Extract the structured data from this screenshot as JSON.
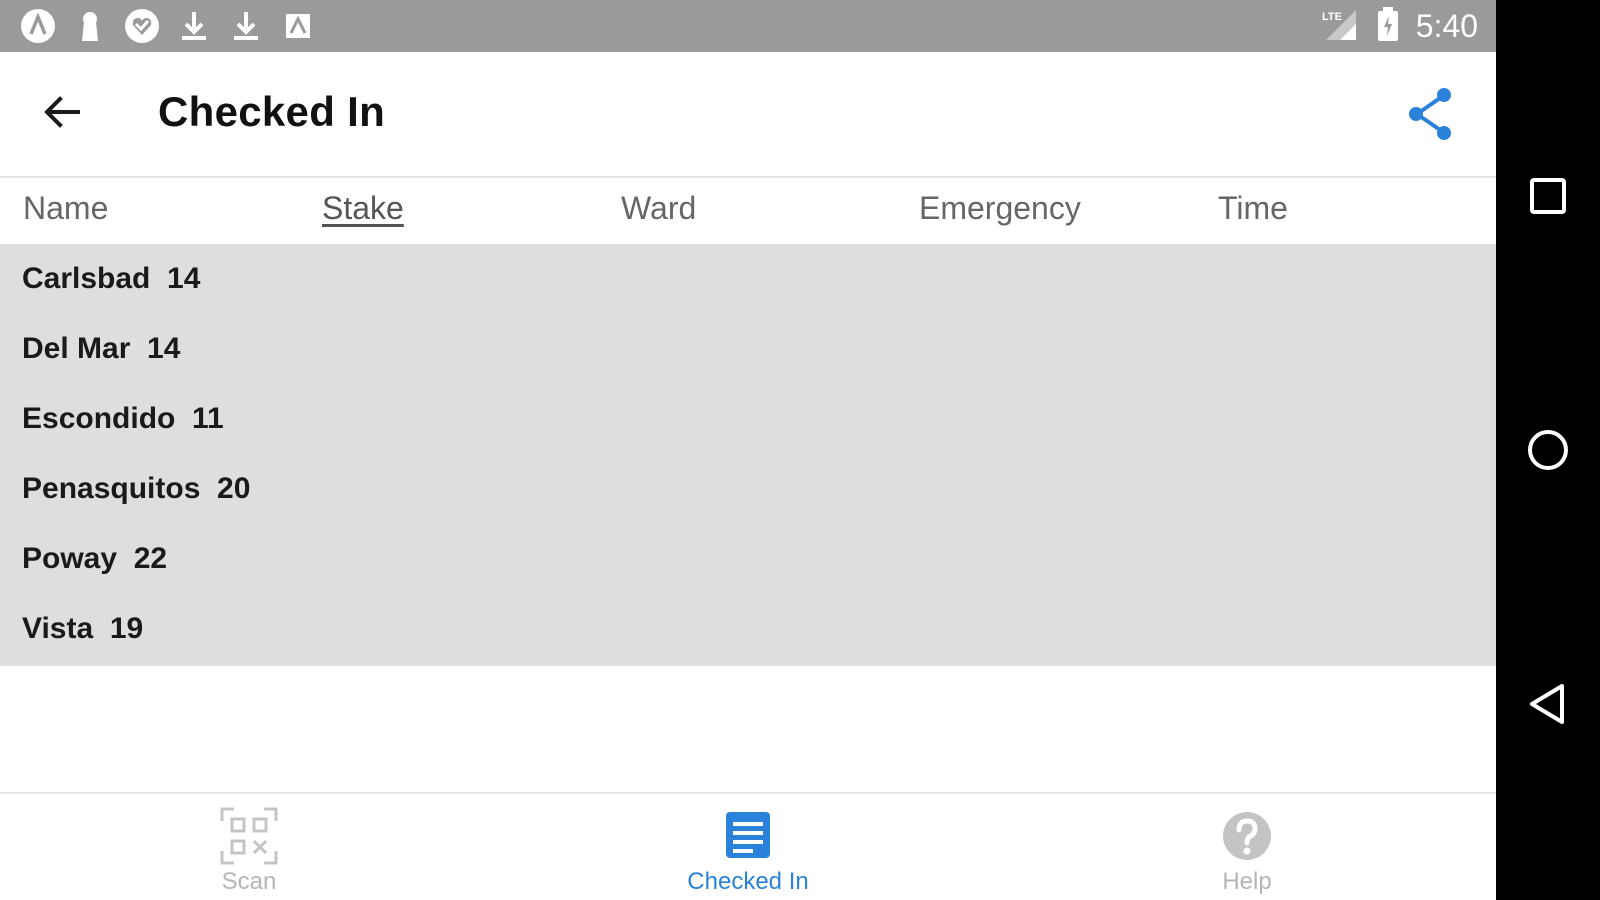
{
  "status_bar": {
    "time": "5:40",
    "notification_icons": [
      "app-a-icon",
      "keyhole-icon",
      "heart-icon",
      "download-icon",
      "download-icon",
      "image-icon"
    ],
    "network_label": "LTE"
  },
  "app_bar": {
    "title": "Checked In",
    "accent_color": "#2a82da"
  },
  "table": {
    "columns": [
      {
        "label": "Name",
        "sorted": false
      },
      {
        "label": "Stake",
        "sorted": true
      },
      {
        "label": "Ward",
        "sorted": false
      },
      {
        "label": "Emergency",
        "sorted": false
      },
      {
        "label": "Time",
        "sorted": false
      }
    ],
    "rows": [
      {
        "label": "Carlsbad  14"
      },
      {
        "label": "Del Mar  14"
      },
      {
        "label": "Escondido  11"
      },
      {
        "label": "Penasquitos  20"
      },
      {
        "label": "Poway  22"
      },
      {
        "label": "Vista  19"
      }
    ]
  },
  "bottom_nav": {
    "items": [
      {
        "label": "Scan",
        "icon": "qr-code-icon",
        "active": false
      },
      {
        "label": "Checked In",
        "icon": "list-icon",
        "active": true
      },
      {
        "label": "Help",
        "icon": "help-icon",
        "active": false
      }
    ]
  },
  "system_nav": {
    "buttons": [
      "recents-icon",
      "home-icon",
      "back-triangle-icon"
    ]
  }
}
